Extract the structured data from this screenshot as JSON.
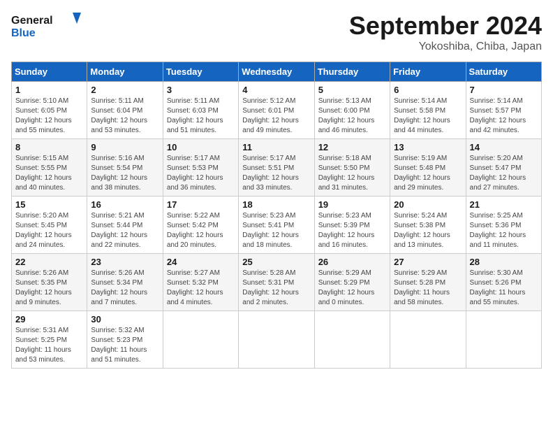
{
  "header": {
    "logo_general": "General",
    "logo_blue": "Blue",
    "month_title": "September 2024",
    "location": "Yokoshiba, Chiba, Japan"
  },
  "weekdays": [
    "Sunday",
    "Monday",
    "Tuesday",
    "Wednesday",
    "Thursday",
    "Friday",
    "Saturday"
  ],
  "weeks": [
    [
      {
        "day": "1",
        "sunrise": "5:10 AM",
        "sunset": "6:05 PM",
        "daylight": "12 hours and 55 minutes."
      },
      {
        "day": "2",
        "sunrise": "5:11 AM",
        "sunset": "6:04 PM",
        "daylight": "12 hours and 53 minutes."
      },
      {
        "day": "3",
        "sunrise": "5:11 AM",
        "sunset": "6:03 PM",
        "daylight": "12 hours and 51 minutes."
      },
      {
        "day": "4",
        "sunrise": "5:12 AM",
        "sunset": "6:01 PM",
        "daylight": "12 hours and 49 minutes."
      },
      {
        "day": "5",
        "sunrise": "5:13 AM",
        "sunset": "6:00 PM",
        "daylight": "12 hours and 46 minutes."
      },
      {
        "day": "6",
        "sunrise": "5:14 AM",
        "sunset": "5:58 PM",
        "daylight": "12 hours and 44 minutes."
      },
      {
        "day": "7",
        "sunrise": "5:14 AM",
        "sunset": "5:57 PM",
        "daylight": "12 hours and 42 minutes."
      }
    ],
    [
      {
        "day": "8",
        "sunrise": "5:15 AM",
        "sunset": "5:55 PM",
        "daylight": "12 hours and 40 minutes."
      },
      {
        "day": "9",
        "sunrise": "5:16 AM",
        "sunset": "5:54 PM",
        "daylight": "12 hours and 38 minutes."
      },
      {
        "day": "10",
        "sunrise": "5:17 AM",
        "sunset": "5:53 PM",
        "daylight": "12 hours and 36 minutes."
      },
      {
        "day": "11",
        "sunrise": "5:17 AM",
        "sunset": "5:51 PM",
        "daylight": "12 hours and 33 minutes."
      },
      {
        "day": "12",
        "sunrise": "5:18 AM",
        "sunset": "5:50 PM",
        "daylight": "12 hours and 31 minutes."
      },
      {
        "day": "13",
        "sunrise": "5:19 AM",
        "sunset": "5:48 PM",
        "daylight": "12 hours and 29 minutes."
      },
      {
        "day": "14",
        "sunrise": "5:20 AM",
        "sunset": "5:47 PM",
        "daylight": "12 hours and 27 minutes."
      }
    ],
    [
      {
        "day": "15",
        "sunrise": "5:20 AM",
        "sunset": "5:45 PM",
        "daylight": "12 hours and 24 minutes."
      },
      {
        "day": "16",
        "sunrise": "5:21 AM",
        "sunset": "5:44 PM",
        "daylight": "12 hours and 22 minutes."
      },
      {
        "day": "17",
        "sunrise": "5:22 AM",
        "sunset": "5:42 PM",
        "daylight": "12 hours and 20 minutes."
      },
      {
        "day": "18",
        "sunrise": "5:23 AM",
        "sunset": "5:41 PM",
        "daylight": "12 hours and 18 minutes."
      },
      {
        "day": "19",
        "sunrise": "5:23 AM",
        "sunset": "5:39 PM",
        "daylight": "12 hours and 16 minutes."
      },
      {
        "day": "20",
        "sunrise": "5:24 AM",
        "sunset": "5:38 PM",
        "daylight": "12 hours and 13 minutes."
      },
      {
        "day": "21",
        "sunrise": "5:25 AM",
        "sunset": "5:36 PM",
        "daylight": "12 hours and 11 minutes."
      }
    ],
    [
      {
        "day": "22",
        "sunrise": "5:26 AM",
        "sunset": "5:35 PM",
        "daylight": "12 hours and 9 minutes."
      },
      {
        "day": "23",
        "sunrise": "5:26 AM",
        "sunset": "5:34 PM",
        "daylight": "12 hours and 7 minutes."
      },
      {
        "day": "24",
        "sunrise": "5:27 AM",
        "sunset": "5:32 PM",
        "daylight": "12 hours and 4 minutes."
      },
      {
        "day": "25",
        "sunrise": "5:28 AM",
        "sunset": "5:31 PM",
        "daylight": "12 hours and 2 minutes."
      },
      {
        "day": "26",
        "sunrise": "5:29 AM",
        "sunset": "5:29 PM",
        "daylight": "12 hours and 0 minutes."
      },
      {
        "day": "27",
        "sunrise": "5:29 AM",
        "sunset": "5:28 PM",
        "daylight": "11 hours and 58 minutes."
      },
      {
        "day": "28",
        "sunrise": "5:30 AM",
        "sunset": "5:26 PM",
        "daylight": "11 hours and 55 minutes."
      }
    ],
    [
      {
        "day": "29",
        "sunrise": "5:31 AM",
        "sunset": "5:25 PM",
        "daylight": "11 hours and 53 minutes."
      },
      {
        "day": "30",
        "sunrise": "5:32 AM",
        "sunset": "5:23 PM",
        "daylight": "11 hours and 51 minutes."
      },
      {
        "day": "",
        "sunrise": "",
        "sunset": "",
        "daylight": ""
      },
      {
        "day": "",
        "sunrise": "",
        "sunset": "",
        "daylight": ""
      },
      {
        "day": "",
        "sunrise": "",
        "sunset": "",
        "daylight": ""
      },
      {
        "day": "",
        "sunrise": "",
        "sunset": "",
        "daylight": ""
      },
      {
        "day": "",
        "sunrise": "",
        "sunset": "",
        "daylight": ""
      }
    ]
  ]
}
